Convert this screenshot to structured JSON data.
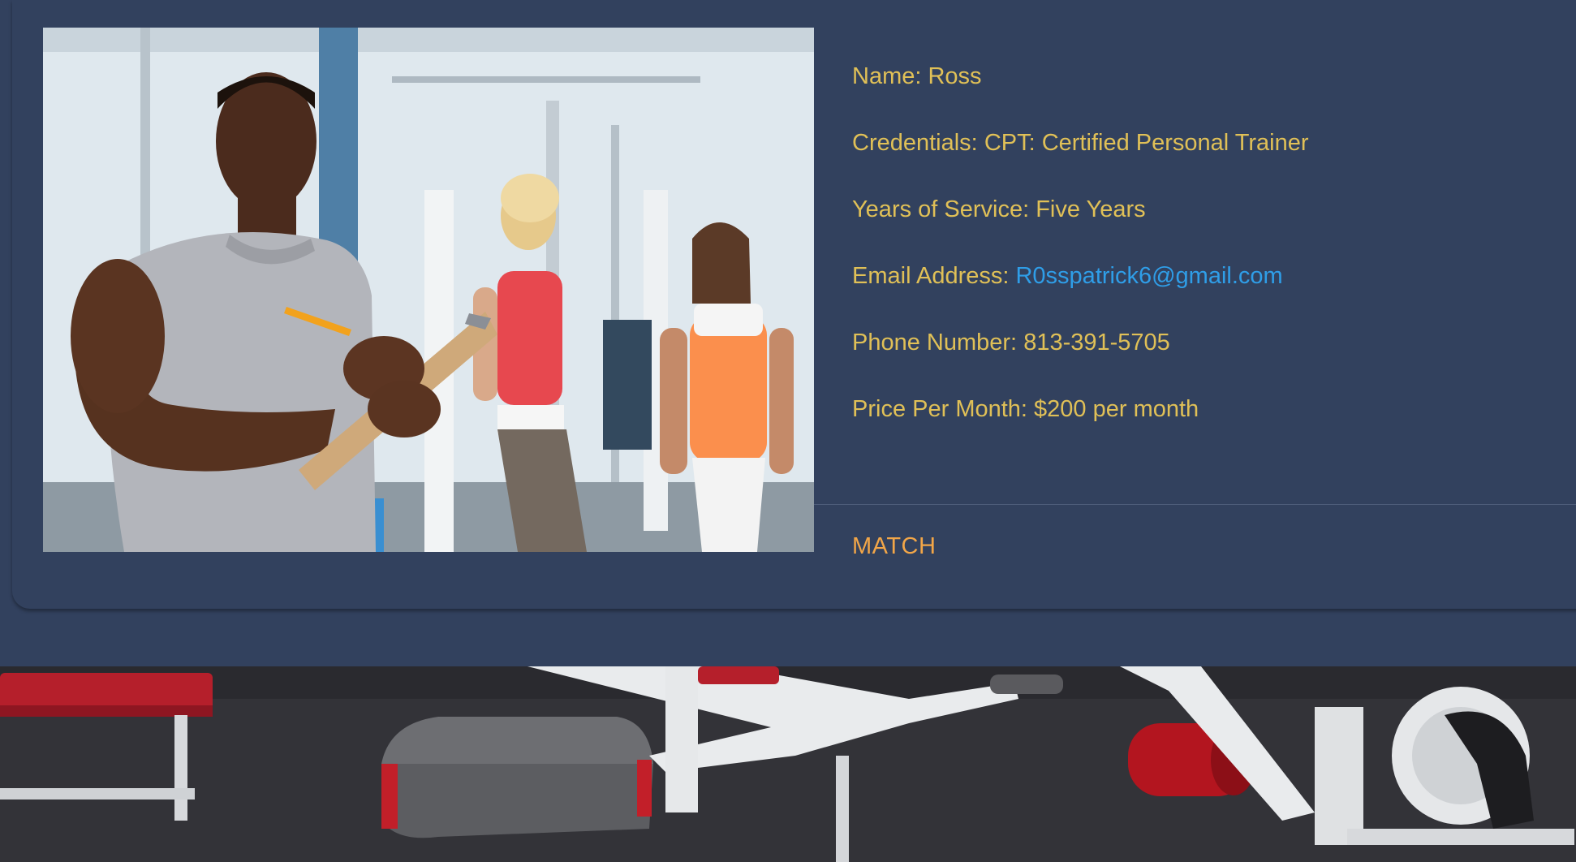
{
  "trainer": {
    "photo_alt": "Trainer with clipboard in gym",
    "name_label": "Name:",
    "name": "Ross",
    "credentials_label": "Credentials:",
    "credentials": "CPT: Certified Personal Trainer",
    "years_label": "Years of Service:",
    "years": "Five Years",
    "email_label": "Email Address:",
    "email": "R0sspatrick6@gmail.com",
    "phone_label": "Phone Number:",
    "phone": "813-391-5705",
    "price_label": "Price Per Month:",
    "price": "$200 per month"
  },
  "actions": {
    "match_label": "MATCH"
  },
  "colors": {
    "page_bg": "#32415e",
    "label_text": "#e0c057",
    "link": "#2f9ee8",
    "match": "#f2a648"
  }
}
